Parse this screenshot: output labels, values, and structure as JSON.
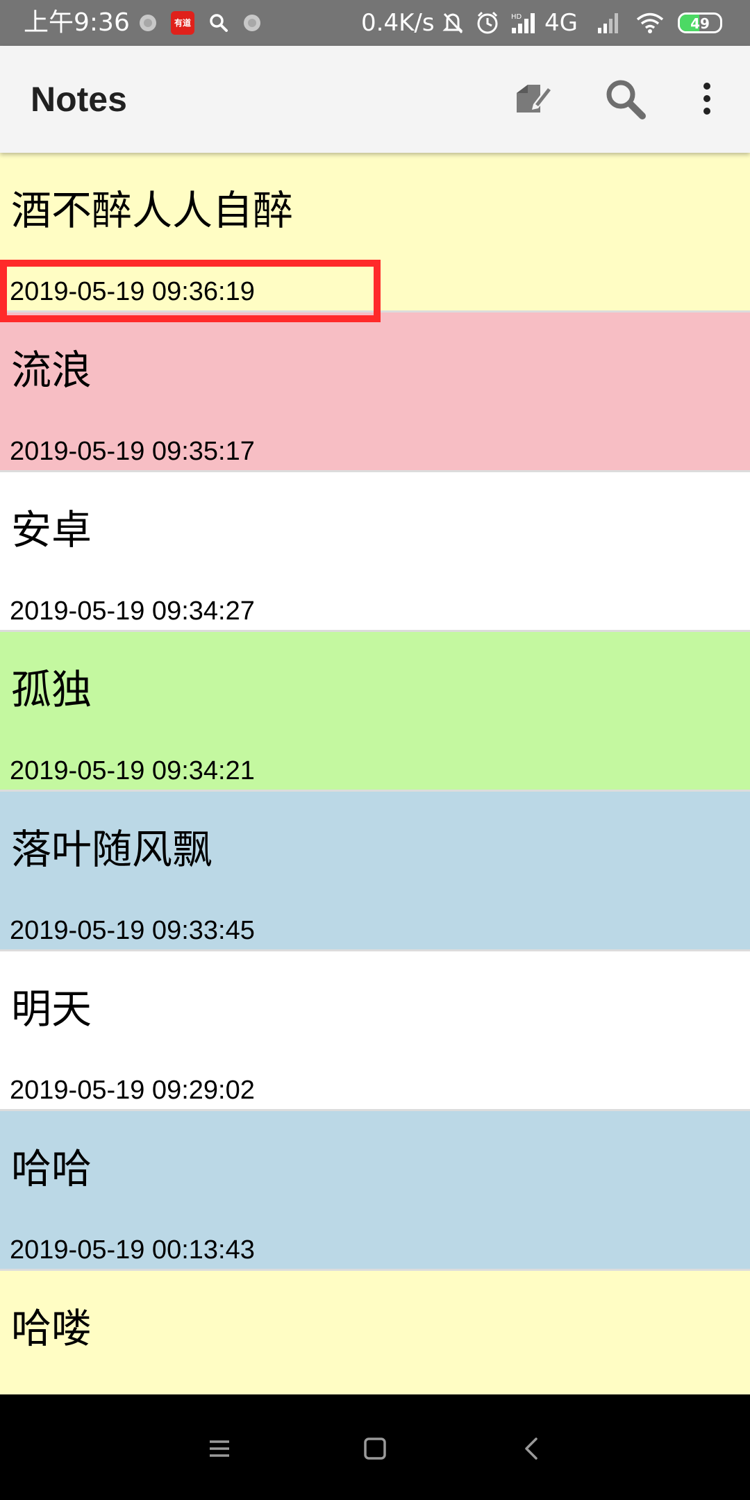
{
  "status_bar": {
    "time": "上午9:36",
    "net_speed": "0.4K/s",
    "network_type": "4G",
    "battery_level": "49",
    "battery_fraction": 0.49,
    "app_badge": "有道",
    "icons": [
      "notification-dot-icon",
      "youdao-app-icon",
      "search-icon",
      "notification-dot-icon",
      "mute-bell-icon",
      "alarm-icon",
      "hd-signal-icon",
      "signal-icon",
      "wifi-icon",
      "battery-icon"
    ]
  },
  "app_bar": {
    "title": "Notes",
    "actions": [
      "new-note-icon",
      "search-icon",
      "more-options-icon"
    ]
  },
  "notes": [
    {
      "title": "酒不醉人人自醉",
      "time": "2019-05-19 09:36:19",
      "color": "#fffdc4"
    },
    {
      "title": "流浪",
      "time": "2019-05-19 09:35:17",
      "color": "#f7bec4"
    },
    {
      "title": "安卓",
      "time": "2019-05-19 09:34:27",
      "color": "#ffffff"
    },
    {
      "title": "孤独",
      "time": "2019-05-19 09:34:21",
      "color": "#c4f8a0"
    },
    {
      "title": "落叶随风飘",
      "time": "2019-05-19 09:33:45",
      "color": "#bbd8e6"
    },
    {
      "title": "明天",
      "time": "2019-05-19 09:29:02",
      "color": "#ffffff"
    },
    {
      "title": "哈哈",
      "time": "2019-05-19 00:13:43",
      "color": "#bbd8e6"
    },
    {
      "title": "哈喽",
      "time": "",
      "color": "#fffdc4"
    }
  ],
  "highlight": {
    "color": "#ff2a2a"
  },
  "nav_bar": {
    "buttons": [
      "menu-icon",
      "home-icon",
      "back-icon"
    ]
  }
}
